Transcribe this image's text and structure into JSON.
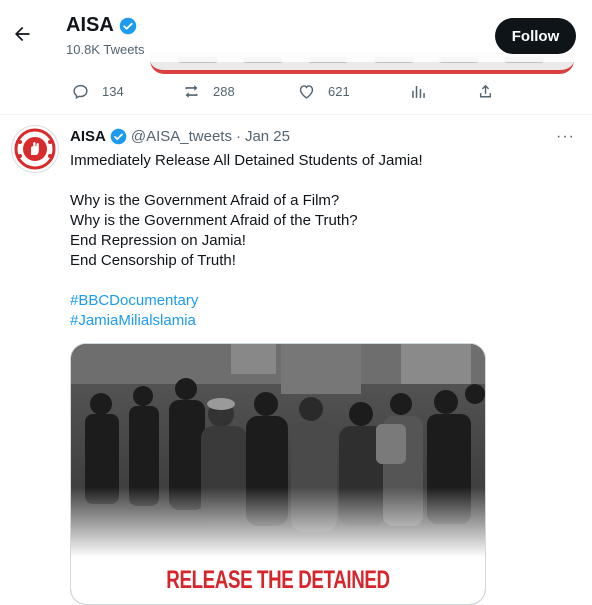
{
  "header": {
    "back_icon": "arrow-left-icon",
    "title": "AISA",
    "tweet_count": "10.8K Tweets",
    "follow_label": "Follow"
  },
  "prev_tweet_actions": {
    "replies": "134",
    "retweets": "288",
    "likes": "621"
  },
  "tweet": {
    "name": "AISA",
    "handle": "@AISA_tweets",
    "separator": "·",
    "date": "Jan 25",
    "more_icon": "···",
    "lines": [
      "Immediately Release All Detained Students of Jamia!",
      "",
      "Why is the Government Afraid of a Film?",
      "Why is the Government Afraid of the Truth?",
      "End Repression on Jamia!",
      "End Censorship of Truth!",
      ""
    ],
    "hashtags": [
      "#BBCDocumentary",
      "#JamiaMilialslamia"
    ],
    "media_caption": "RELEASE THE DETAINED"
  },
  "colors": {
    "accent": "#1d9bf0",
    "follow_bg": "#0f1419",
    "caption_red": "#d7262b",
    "logo_red": "#d92b2b"
  }
}
